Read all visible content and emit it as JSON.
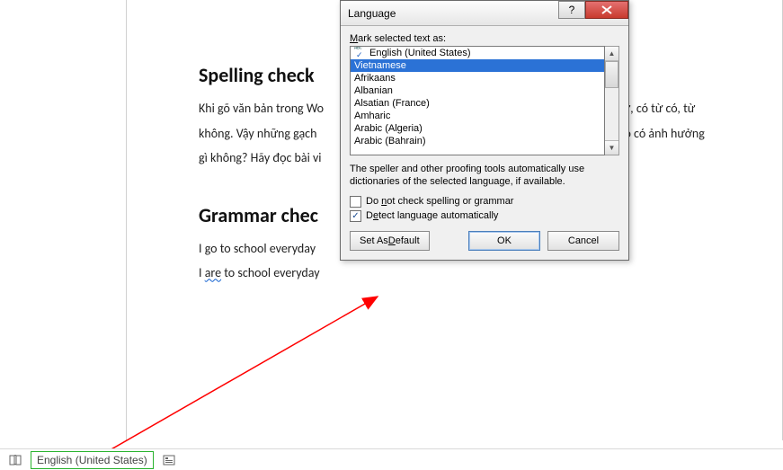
{
  "document": {
    "heading1": "Spelling check",
    "para1": "Khi gõ văn bản trong Wo",
    "para1_mid": "i các từ, có từ có, từ",
    "para1b": "không. Vậy những gạch",
    "para1b_mid": "rd, và bỏ có ảnh hưởng",
    "para1c": "gì không? Hãy đọc bài vi",
    "heading2": "Grammar chec",
    "para2": "I go to school everyday",
    "para3_pre": "I ",
    "para3_err": "are",
    "para3_post": " to school everyday"
  },
  "dialog": {
    "title": "Language",
    "mark_label_pre": "",
    "mark_label_u": "M",
    "mark_label_post": "ark selected text as:",
    "items": {
      "default": "English (United States)",
      "selected": "Vietnamese",
      "i2": "Afrikaans",
      "i3": "Albanian",
      "i4": "Alsatian (France)",
      "i5": "Amharic",
      "i6": "Arabic (Algeria)",
      "i7": "Arabic (Bahrain)"
    },
    "hint": "The speller and other proofing tools automatically use dictionaries of the selected language, if available.",
    "chk1_pre": "Do ",
    "chk1_u": "n",
    "chk1_post": "ot check spelling or grammar",
    "chk2_pre": "D",
    "chk2_u": "e",
    "chk2_post": "tect language automatically",
    "btn_default_pre": "Set As ",
    "btn_default_u": "D",
    "btn_default_post": "efault",
    "btn_ok": "OK",
    "btn_cancel": "Cancel"
  },
  "statusbar": {
    "lang": "English (United States)"
  }
}
